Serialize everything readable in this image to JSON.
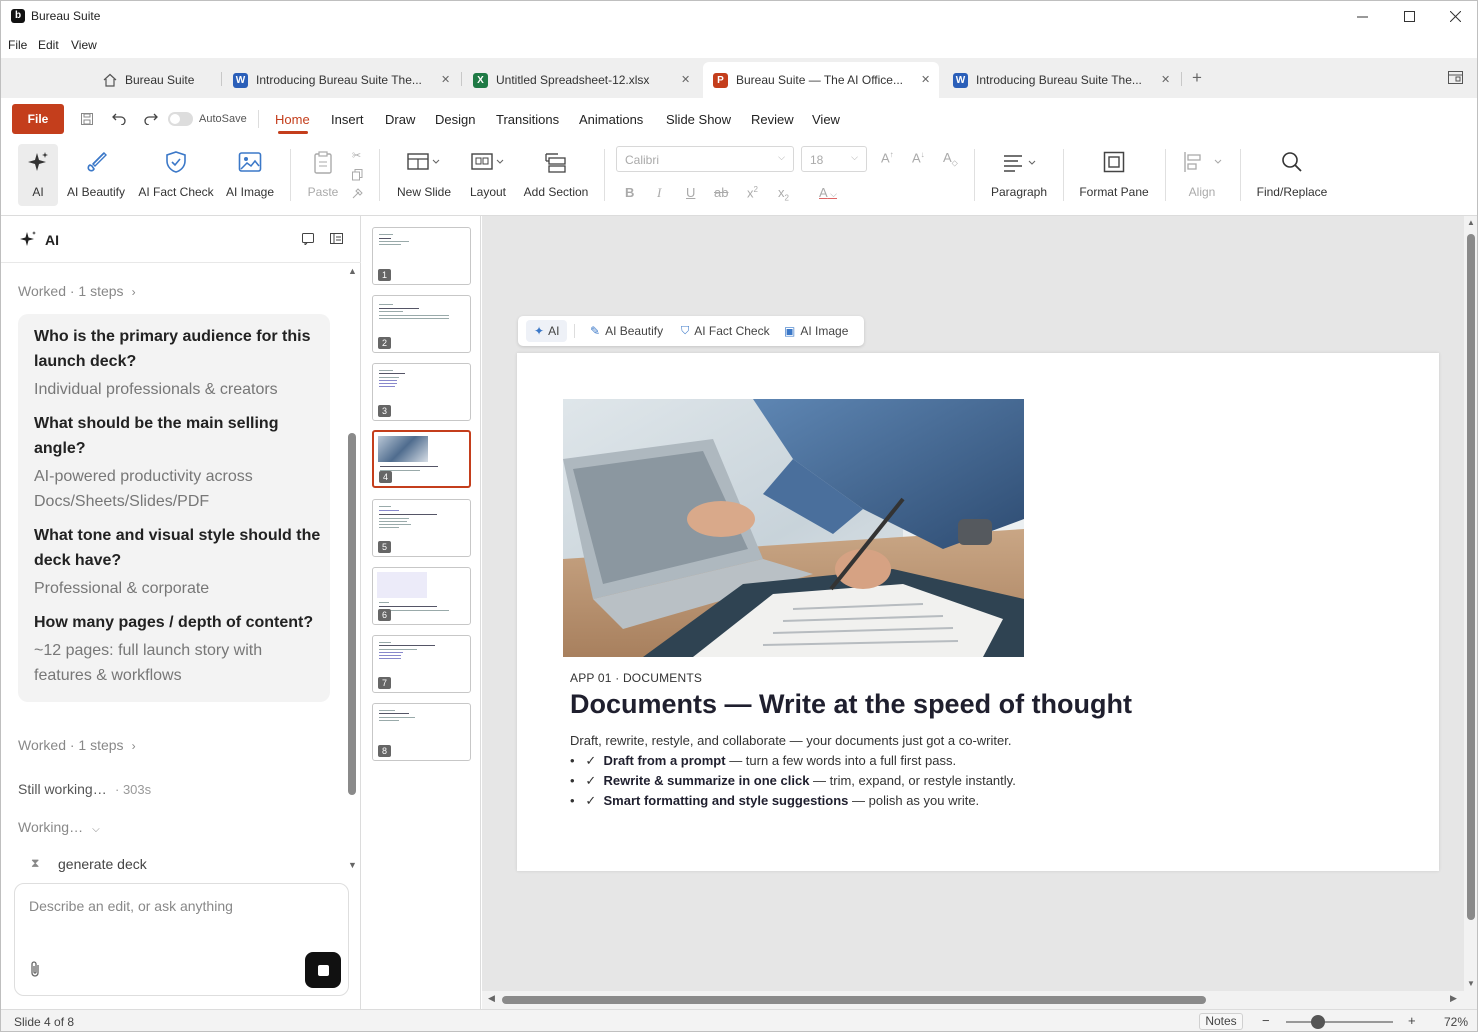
{
  "window": {
    "app_name": "Bureau Suite",
    "logo_letter": "b"
  },
  "menubar": [
    "File",
    "Edit",
    "View"
  ],
  "tabs": [
    {
      "label": "Bureau Suite",
      "icon": "home-icon"
    },
    {
      "label": "Introducing Bureau Suite The...",
      "icon": "W",
      "type": "word"
    },
    {
      "label": "Untitled Spreadsheet-12.xlsx",
      "icon": "X",
      "type": "sheet"
    },
    {
      "label": "Bureau Suite — The AI Office...",
      "icon": "P",
      "type": "slides",
      "active": true
    },
    {
      "label": "Introducing Bureau Suite The...",
      "icon": "W",
      "type": "word"
    }
  ],
  "ribbon_tabs": {
    "file": "File",
    "autosave": "AutoSave",
    "items": [
      "Home",
      "Insert",
      "Draw",
      "Design",
      "Transitions",
      "Animations",
      "Slide Show",
      "Review",
      "View"
    ],
    "active": "Home"
  },
  "ribbon": {
    "ai": "AI",
    "ai_beautify": "AI Beautify",
    "ai_fact_check": "AI Fact Check",
    "ai_image": "AI Image",
    "paste": "Paste",
    "new_slide": "New Slide",
    "layout": "Layout",
    "add_section": "Add Section",
    "font_name": "Calibri",
    "font_size": "18",
    "paragraph": "Paragraph",
    "format_pane": "Format Pane",
    "align": "Align",
    "find_replace": "Find/Replace"
  },
  "ai_panel": {
    "title": "AI",
    "worked_1": "Worked · 1 steps",
    "qa": [
      {
        "q": "Who is the primary audience for this launch deck?",
        "a": "Individual professionals & creators"
      },
      {
        "q": "What should be the main selling angle?",
        "a": "AI-powered productivity across Docs/Sheets/Slides/PDF"
      },
      {
        "q": "What tone and visual style should the deck have?",
        "a": "Professional & corporate"
      },
      {
        "q": "How many pages / depth of content?",
        "a": "~12 pages: full launch story with features & workflows"
      }
    ],
    "worked_2": "Worked · 1 steps",
    "still_working": "Still working…",
    "elapsed": "· 303s",
    "working": "Working…",
    "task": "generate deck",
    "input_placeholder": "Describe an edit, or ask anything"
  },
  "thumbnails": [
    1,
    2,
    3,
    4,
    5,
    6,
    7,
    8
  ],
  "active_slide": 4,
  "float_toolbar": {
    "ai": "AI",
    "beautify": "AI Beautify",
    "fact_check": "AI Fact Check",
    "image": "AI Image"
  },
  "slide": {
    "kicker": "APP 01 · DOCUMENTS",
    "title": "Documents — Write at the speed of thought",
    "subtitle": "Draft, rewrite, restyle, and collaborate — your documents just got a co-writer.",
    "bullets": [
      {
        "bold": "Draft from a prompt",
        "rest": " — turn a few words into a full first pass."
      },
      {
        "bold": "Rewrite & summarize in one click",
        "rest": " — trim, expand, or restyle instantly."
      },
      {
        "bold": "Smart formatting and style suggestions",
        "rest": " — polish as you write."
      }
    ]
  },
  "status": {
    "slide_counter": "Slide 4 of 8",
    "notes": "Notes",
    "zoom": "72%",
    "zoom_fraction": 0.3
  },
  "colors": {
    "accent": "#c43e1c",
    "word": "#2b5fb9",
    "sheet": "#1f7a45"
  }
}
